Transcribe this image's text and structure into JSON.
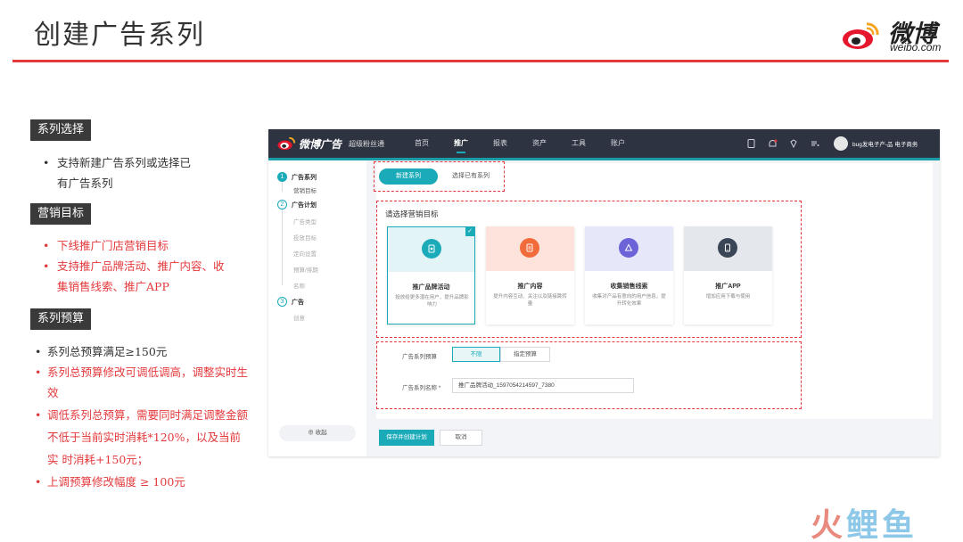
{
  "slide": {
    "title": "创建广告系列",
    "logo": {
      "cn": "微博",
      "en": "weibo.com"
    }
  },
  "notes": {
    "series_select": {
      "label": "系列选择",
      "items": [
        "支持新建广告系列或选择已",
        "有广告系列"
      ]
    },
    "marketing_goal": {
      "label": "营销目标",
      "items": [
        "下线推广门店营销目标",
        "支持推广品牌活动、推广内容、收",
        "集销售线索、推广APP"
      ]
    },
    "series_budget": {
      "label": "系列预算",
      "items": [
        "系列总预算满足≥150元",
        "系列总预算修改可调低调高，调整实时生",
        "效",
        "调低系列总预算，需要同时满足调整金额",
        "不低于当前实时消耗*120%，以及当前",
        "实 时消耗+150元；",
        "上调预算修改幅度 ≥ 100元"
      ]
    }
  },
  "app": {
    "brand": "微博广告",
    "brand_sub": "超级粉丝通",
    "nav": [
      "首页",
      "推广",
      "报表",
      "资产",
      "工具",
      "账户"
    ],
    "nav_active": "推广",
    "user": "bug发电子产-品 电子商务",
    "sidebar": {
      "step1": {
        "num": "1",
        "label": "广告系列",
        "subs": [
          "营销目标"
        ]
      },
      "step2": {
        "num": "2",
        "label": "广告计划",
        "subs": [
          "广告类型",
          "投放目标",
          "定向设置",
          "预算/排期",
          "名称"
        ]
      },
      "step3": {
        "num": "3",
        "label": "广告",
        "subs": [
          "创意"
        ]
      },
      "collapse": "⊕ 收起"
    },
    "tabs": {
      "new": "新建系列",
      "existing": "选择已有系列"
    },
    "goal_heading": "请选择营销目标",
    "goals": [
      {
        "title": "推广品牌活动",
        "desc": "投放给更多潜在用户，提升品牌影响力",
        "icon": "star-badge-icon",
        "color": "#1aaab8",
        "bg": "#e3f4f6"
      },
      {
        "title": "推广内容",
        "desc": "提升内容互动、关注以及链接跳转量",
        "icon": "document-icon",
        "color": "#f26b3a",
        "bg": "#fde3dc"
      },
      {
        "title": "收集销售线索",
        "desc": "收集对产品有意向的用户信息，提升转化效果",
        "icon": "triangle-icon",
        "color": "#6c63d9",
        "bg": "#e6e7f8"
      },
      {
        "title": "推广APP",
        "desc": "增加应用下载与使用",
        "icon": "phone-icon",
        "color": "#3a4656",
        "bg": "#e4e7ec"
      }
    ],
    "budget": {
      "label": "广告系列预算",
      "unlimited": "不限",
      "specify": "指定预算"
    },
    "name_field": {
      "label": "广告系列名称 *",
      "value": "推广品牌活动_1597054214597_7380"
    },
    "actions": {
      "save": "保存并创建计划",
      "cancel": "取消"
    }
  },
  "watermark": {
    "a": "火",
    "b": "鲤",
    "c": "鱼"
  },
  "colors": {
    "accent": "#1aaab8",
    "red": "#e4393c",
    "topbar": "#2d3340"
  }
}
